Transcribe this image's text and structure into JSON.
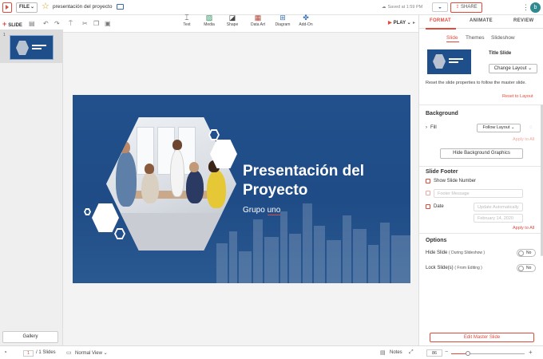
{
  "app": {
    "file_label": "FILE",
    "doc_title": "presentación del proyecto",
    "saved_status": "Saved at 1:59 PM",
    "share_label": "SHARE",
    "avatar_initial": "b",
    "colors": {
      "accent": "#e04b3c",
      "slide_bg": "#21508c",
      "panel_bg": "#ffffff"
    }
  },
  "toolbar": {
    "add_slide_label": "SLIDE",
    "insert": [
      {
        "label": "Text",
        "icon": "text-icon"
      },
      {
        "label": "Media",
        "icon": "media-icon"
      },
      {
        "label": "Shape",
        "icon": "shape-icon"
      },
      {
        "label": "Data Art",
        "icon": "data-art-icon"
      },
      {
        "label": "Diagram",
        "icon": "diagram-icon"
      },
      {
        "label": "Add-On",
        "icon": "add-on-icon"
      }
    ],
    "play_label": "PLAY"
  },
  "left_panel": {
    "slide_number": "1",
    "gallery_label": "Gallery"
  },
  "slide": {
    "title": "Presentación del Proyecto",
    "subtitle_prefix": "Grupo ",
    "subtitle_underlined": "uno"
  },
  "right_panel": {
    "tabs": [
      "FORMAT",
      "ANIMATE",
      "REVIEW"
    ],
    "active_tab": "FORMAT",
    "subtabs": [
      "Slide",
      "Themes",
      "Slideshow"
    ],
    "active_subtab": "Slide",
    "layout_name": "Title Slide",
    "change_layout_label": "Change Layout",
    "reset_description": "Reset the slide properties to follow the master slide.",
    "reset_link": "Reset to Layout",
    "background": {
      "title": "Background",
      "fill_label": "Fill",
      "fill_value": "Follow Layout",
      "apply_all": "Apply to All",
      "hide_graphics_label": "Hide Background Graphics"
    },
    "footer": {
      "title": "Slide Footer",
      "show_number_label": "Show Slide Number",
      "footer_placeholder": "Footer Message",
      "date_label": "Date",
      "date_mode": "Update Automatically",
      "date_value": "February 14, 2020",
      "apply_all": "Apply to All"
    },
    "options": {
      "title": "Options",
      "hide_slide_label": "Hide Slide",
      "hide_slide_note": "( During Slideshow )",
      "lock_slide_label": "Lock Slide(s)",
      "lock_slide_note": "( From Editing )",
      "toggle_off": "No"
    },
    "edit_master_label": "Edit Master Slide"
  },
  "status": {
    "current_page": "1",
    "total_pages": "/ 1 Slides",
    "view_mode": "Normal View",
    "notes_label": "Notes",
    "zoom": "86",
    "zoom_fraction": 0.23
  }
}
